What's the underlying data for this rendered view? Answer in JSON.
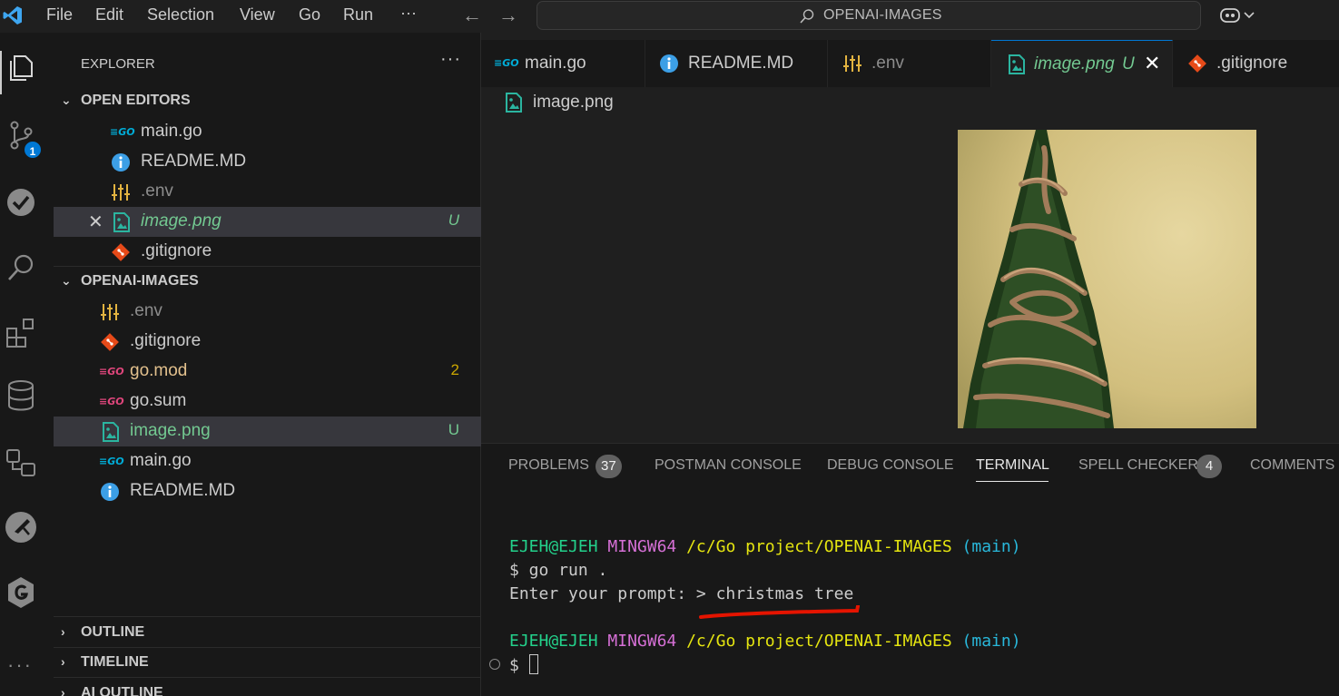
{
  "titlebar": {
    "menu": [
      "File",
      "Edit",
      "Selection",
      "View",
      "Go",
      "Run"
    ],
    "more": "···",
    "search_text": "OPENAI-IMAGES"
  },
  "activitybar": {
    "items": [
      "explorer-icon",
      "source-control-icon",
      "testing-icon",
      "search-icon",
      "extensions-icon",
      "database-icon",
      "remote-explorer-icon",
      "postman-icon",
      "gitkraken-icon"
    ],
    "source_control_badge": "1",
    "more": "···"
  },
  "sidebar": {
    "title": "EXPLORER",
    "more": "···",
    "open_editors": {
      "header": "OPEN EDITORS",
      "items": [
        {
          "label": "main.go",
          "icon": "go-file-icon",
          "decoration": ""
        },
        {
          "label": "README.MD",
          "icon": "info-icon",
          "decoration": ""
        },
        {
          "label": ".env",
          "icon": "env-settings-icon",
          "decoration": ""
        },
        {
          "label": "image.png",
          "icon": "image-file-icon",
          "decoration": "U"
        },
        {
          "label": ".gitignore",
          "icon": "git-icon",
          "decoration": ""
        }
      ]
    },
    "project": {
      "header": "OPENAI-IMAGES",
      "items": [
        {
          "label": ".env",
          "icon": "env-settings-icon",
          "decoration": ""
        },
        {
          "label": ".gitignore",
          "icon": "git-icon",
          "decoration": ""
        },
        {
          "label": "go.mod",
          "icon": "go-mod-icon",
          "decoration": "2"
        },
        {
          "label": "go.sum",
          "icon": "go-mod-icon",
          "decoration": ""
        },
        {
          "label": "image.png",
          "icon": "image-file-icon",
          "decoration": "U"
        },
        {
          "label": "main.go",
          "icon": "go-file-icon",
          "decoration": ""
        },
        {
          "label": "README.MD",
          "icon": "info-icon",
          "decoration": ""
        }
      ]
    },
    "outline": "OUTLINE",
    "timeline": "TIMELINE",
    "ai_outline": "AI OUTLINE"
  },
  "editor": {
    "tabs": [
      {
        "label": "main.go",
        "icon": "go-file-icon"
      },
      {
        "label": "README.MD",
        "icon": "info-icon"
      },
      {
        "label": ".env",
        "icon": "env-settings-icon"
      },
      {
        "label": "image.png",
        "icon": "image-file-icon",
        "decoration": "U",
        "active": true
      },
      {
        "label": ".gitignore",
        "icon": "git-icon"
      }
    ],
    "breadcrumb": "image.png"
  },
  "panel": {
    "tabs": [
      {
        "label": "PROBLEMS",
        "badge": "37"
      },
      {
        "label": "POSTMAN CONSOLE"
      },
      {
        "label": "DEBUG CONSOLE"
      },
      {
        "label": "TERMINAL",
        "active": true
      },
      {
        "label": "SPELL CHECKER",
        "badge": "4"
      },
      {
        "label": "COMMENTS"
      }
    ],
    "terminal": {
      "line1": {
        "user": "EJEH@EJEH",
        "host": "MINGW64",
        "path": "/c/Go project/OPENAI-IMAGES",
        "branch": "(main)"
      },
      "line2": "$ go run .",
      "line3": "Enter your prompt: > christmas tree",
      "line4": {
        "user": "EJEH@EJEH",
        "host": "MINGW64",
        "path": "/c/Go project/OPENAI-IMAGES",
        "branch": "(main)"
      },
      "line5": "$ "
    }
  },
  "colors": {
    "accent": "#0078d4",
    "untracked": "#73c991",
    "modified": "#e2c08d",
    "annotation": "#e51400"
  }
}
